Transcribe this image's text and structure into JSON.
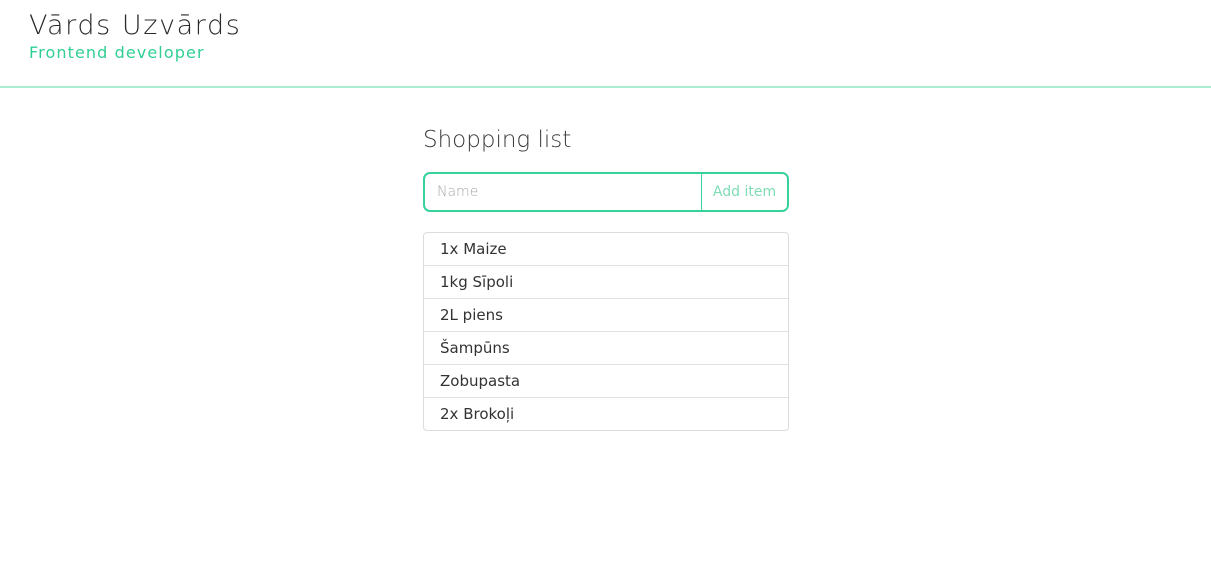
{
  "header": {
    "name": "Vārds Uzvārds",
    "role": "Frontend developer"
  },
  "shopping": {
    "title": "Shopping list",
    "input_placeholder": "Name",
    "input_value": "",
    "add_button_label": "Add item",
    "items": [
      "1x Maize",
      "1kg Sīpoli",
      "2L piens",
      "Šampūns",
      "Zobupasta",
      "2x Brokoļi"
    ]
  },
  "colors": {
    "accent": "#35d29a",
    "header_border": "#a9ecd0",
    "role_text": "#2fcf93",
    "button_text": "#7fdcb6"
  }
}
